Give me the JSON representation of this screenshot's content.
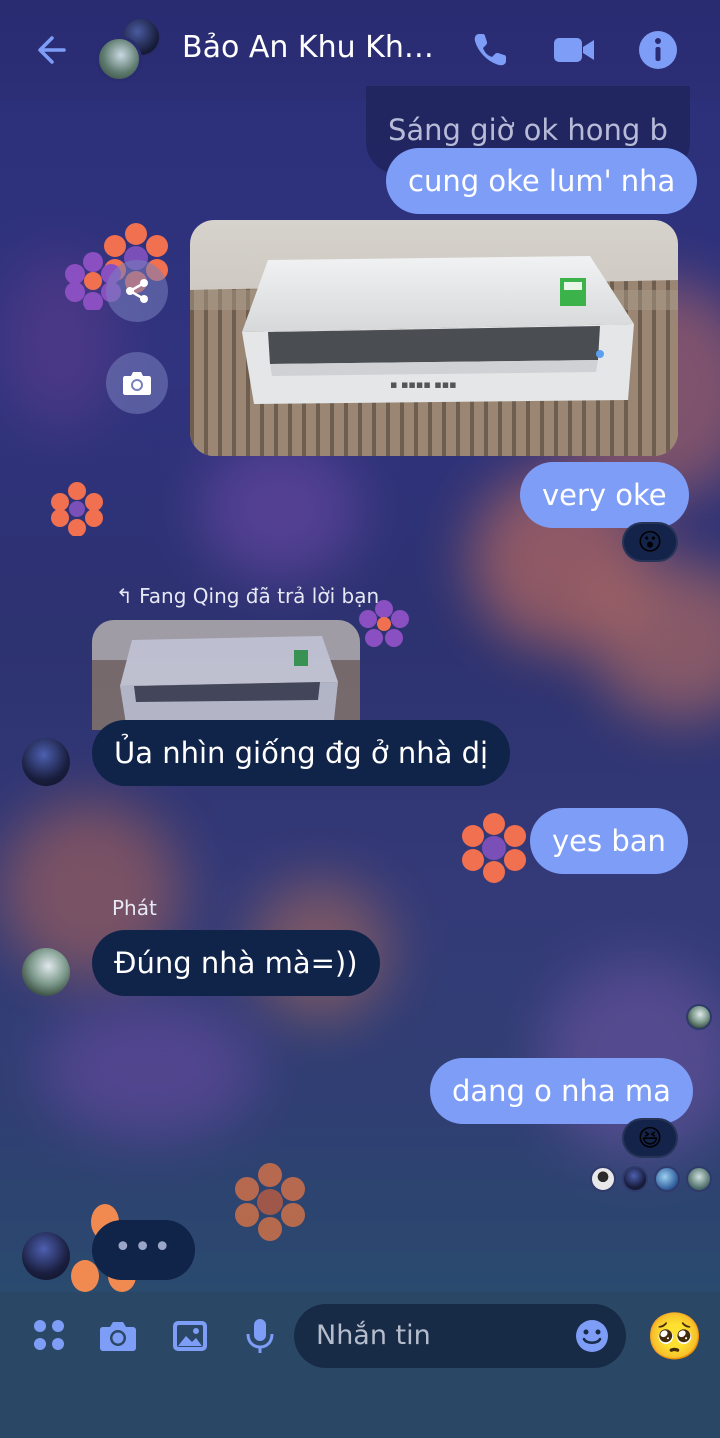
{
  "header": {
    "title": "Bảo An Khu Khác...",
    "colors": {
      "accent": "#7e9df7",
      "bg": "#2a2c72"
    }
  },
  "messages": {
    "m1_faded": "Sáng giờ ok hong b",
    "m2": "cung oke lum' nha",
    "m3": "very oke",
    "m3_reaction": "😮",
    "reply_note": "Fang Qing đã trả lời bạn",
    "m4": "Ủa nhìn giống đg ở nhà dị",
    "m5": "yes ban",
    "sender_name": "Phát",
    "m6": "Đúng nhà mà=))",
    "m7": "dang o nha ma",
    "m7_reaction": "😆",
    "typing": "•••"
  },
  "composer": {
    "placeholder": "Nhắn tin",
    "emoji": "🥺"
  },
  "icons": [
    "back-arrow-icon",
    "phone-icon",
    "video-icon",
    "info-icon",
    "share-icon",
    "camera-icon",
    "apps-icon",
    "photo-icon",
    "mic-icon",
    "sticker-icon"
  ]
}
